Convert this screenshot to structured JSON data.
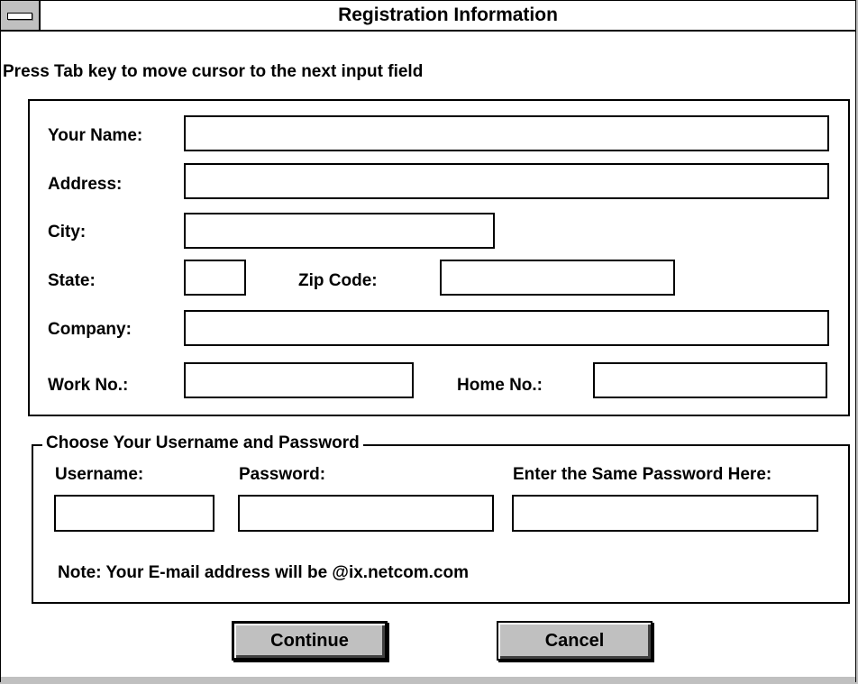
{
  "window": {
    "title": "Registration Information"
  },
  "instruction": "Press Tab key to move cursor to the next input field",
  "contact": {
    "name_label": "Your Name:",
    "address_label": "Address:",
    "city_label": "City:",
    "state_label": "State:",
    "zip_label": "Zip Code:",
    "company_label": "Company:",
    "work_label": "Work No.:",
    "home_label": "Home No.:",
    "name_value": "",
    "address_value": "",
    "city_value": "",
    "state_value": "",
    "zip_value": "",
    "company_value": "",
    "work_value": "",
    "home_value": ""
  },
  "account": {
    "group_title": "Choose Your Username and Password",
    "username_label": "Username:",
    "password_label": "Password:",
    "confirm_label": "Enter the Same Password Here:",
    "username_value": "",
    "password_value": "",
    "confirm_value": "",
    "note": "Note: Your E-mail address will be @ix.netcom.com"
  },
  "buttons": {
    "continue_label": "Continue",
    "cancel_label": "Cancel"
  }
}
